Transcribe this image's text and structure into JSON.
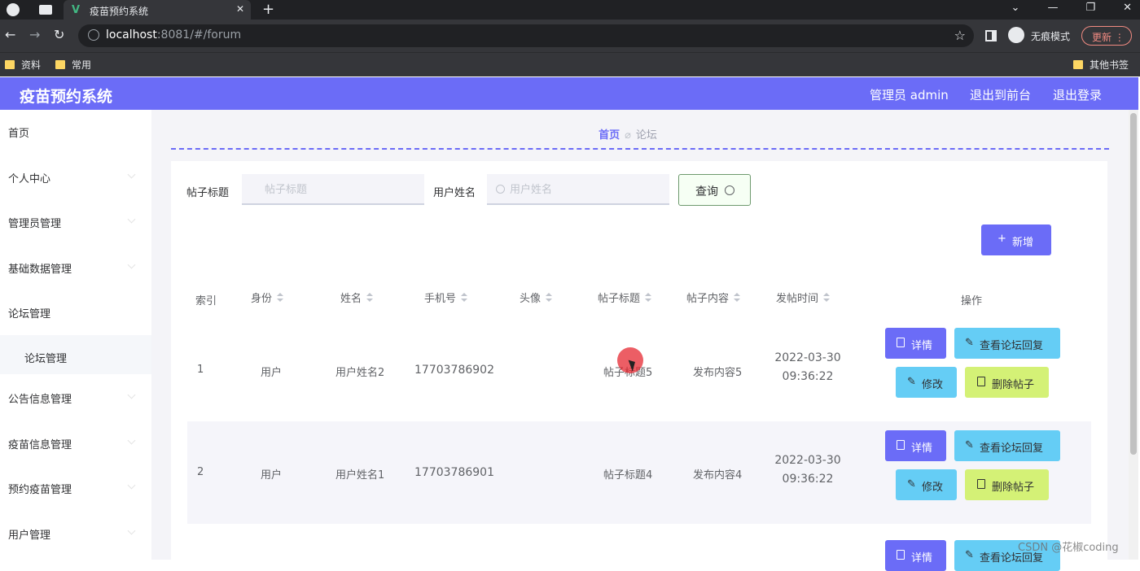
{
  "browser": {
    "tab_title": "疫苗预约系统",
    "url_host": "localhost",
    "url_rest": ":8081/#/forum",
    "incognito_label": "无痕模式",
    "update_label": "更新",
    "bookmarks": [
      "资料",
      "常用"
    ],
    "other_bookmarks": "其他书签"
  },
  "app": {
    "title": "疫苗预约系统",
    "admin_label": "管理员 admin",
    "to_front_label": "退出到前台",
    "logout_label": "退出登录"
  },
  "sidebar": {
    "items": [
      {
        "label": "首页"
      },
      {
        "label": "个人中心"
      },
      {
        "label": "管理员管理"
      },
      {
        "label": "基础数据管理"
      },
      {
        "label": "论坛管理"
      },
      {
        "label": "论坛管理"
      },
      {
        "label": "公告信息管理"
      },
      {
        "label": "疫苗信息管理"
      },
      {
        "label": "预约疫苗管理"
      },
      {
        "label": "用户管理"
      }
    ]
  },
  "breadcrumb": {
    "home": "首页",
    "current": "论坛"
  },
  "search": {
    "title_label": "帖子标题",
    "title_placeholder": "帖子标题",
    "username_label": "用户姓名",
    "username_placeholder": "用户姓名",
    "query_label": "查询"
  },
  "add_label": "新增",
  "table": {
    "headers": [
      "索引",
      "身份",
      "姓名",
      "手机号",
      "头像",
      "帖子标题",
      "帖子内容",
      "发帖时间",
      "操作"
    ],
    "rows": [
      {
        "index": "1",
        "identity": "用户",
        "name": "用户姓名2",
        "phone": "17703786902",
        "title": "帖子标题5",
        "content": "发布内容5",
        "time": "2022-03-30 09:36:22"
      },
      {
        "index": "2",
        "identity": "用户",
        "name": "用户姓名1",
        "phone": "17703786901",
        "title": "帖子标题4",
        "content": "发布内容4",
        "time": "2022-03-30 09:36:22"
      }
    ],
    "actions": {
      "detail": "详情",
      "view_reply": "查看论坛回复",
      "edit": "修改",
      "delete": "删除帖子"
    }
  },
  "watermark": "CSDN @花椒coding"
}
